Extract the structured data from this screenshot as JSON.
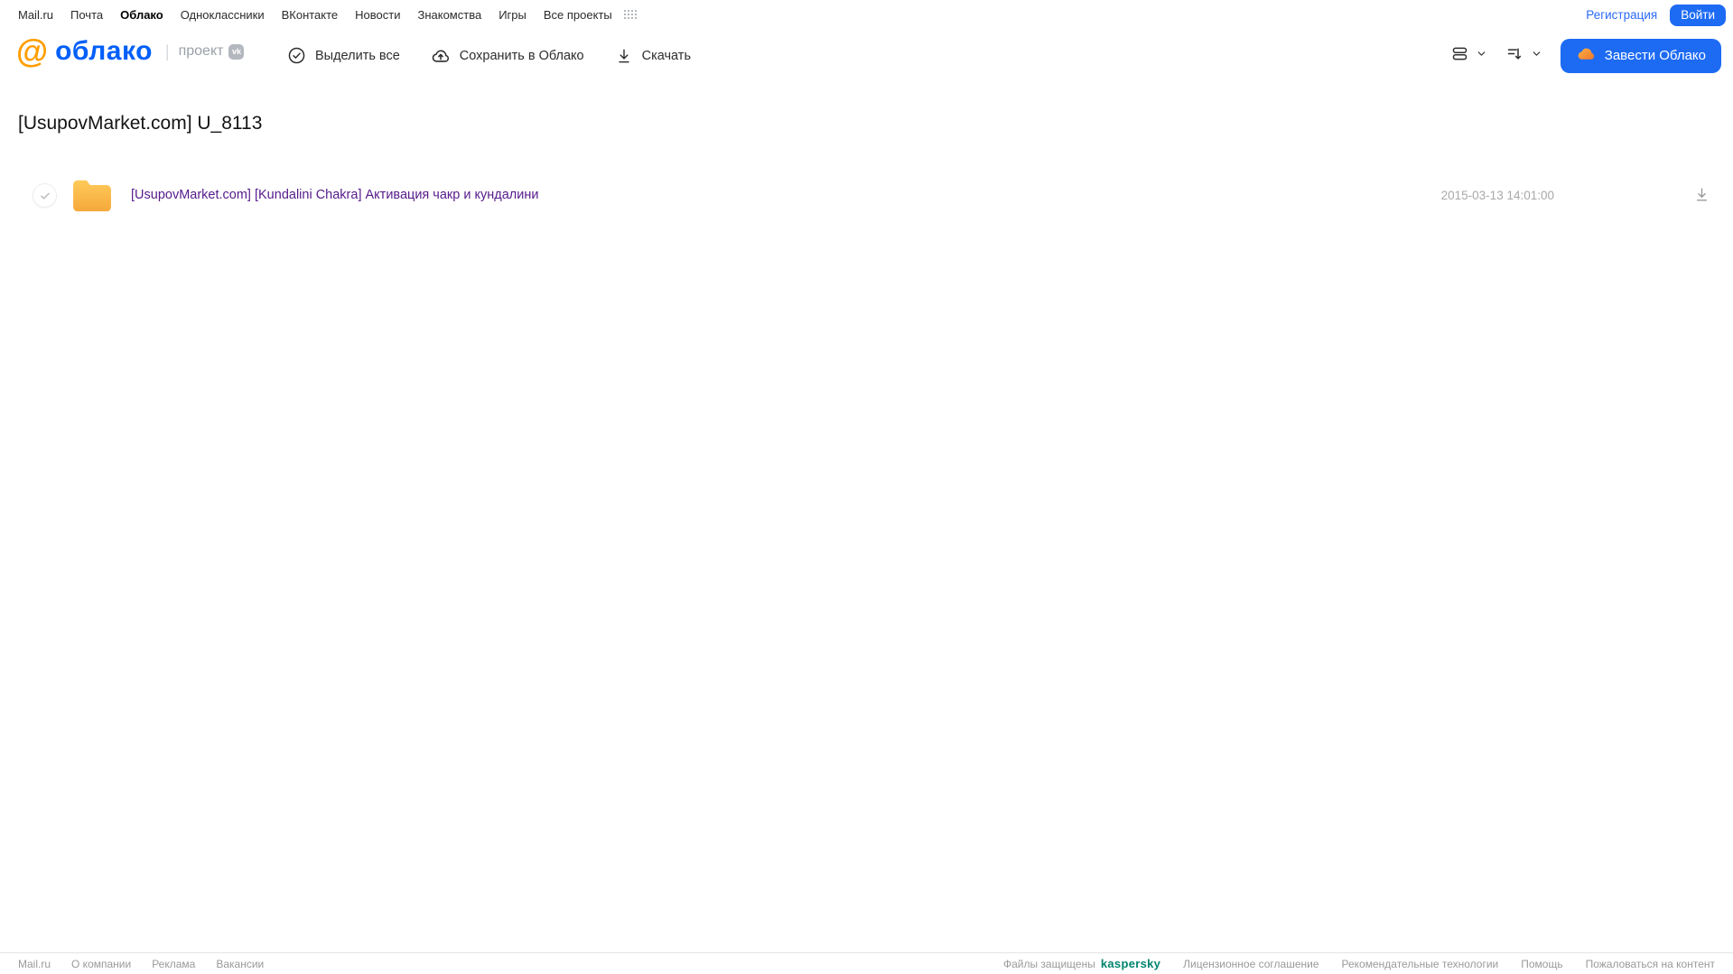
{
  "top_nav": {
    "items": [
      "Mail.ru",
      "Почта",
      "Облако",
      "Одноклассники",
      "ВКонтакте",
      "Новости",
      "Знакомства",
      "Игры",
      "Все проекты"
    ],
    "active_item": "Облако",
    "register_label": "Регистрация",
    "login_label": "Войти"
  },
  "header": {
    "logo_at": "@",
    "logo_text": "облако",
    "logo_divider": "|",
    "project_label": "проект",
    "vk_badge": "vk",
    "actions": {
      "select_all": "Выделить все",
      "save_to_cloud": "Сохранить в Облако",
      "download": "Скачать"
    },
    "get_cloud_button": "Завести Облако"
  },
  "page": {
    "title": "[UsupovMarket.com] U_8113"
  },
  "file_list": {
    "rows": [
      {
        "type": "folder",
        "name": "[UsupovMarket.com] [Kundalini Chakra] Активация чакр и кундалини",
        "date": "2015-03-13 14:01:00"
      }
    ]
  },
  "footer": {
    "left_links": [
      "Mail.ru",
      "О компании",
      "Реклама",
      "Вакансии"
    ],
    "protected_label": "Файлы защищены",
    "kaspersky_label": "kaspersky",
    "right_links": [
      "Лицензионное соглашение",
      "Рекомендательные технологии",
      "Помощь",
      "Пожаловаться на контент"
    ]
  },
  "colors": {
    "brand_blue": "#005ff9",
    "button_blue": "#1d6bf3",
    "logo_orange": "#ff9e00",
    "folder_amber_top": "#ffcb5c",
    "folder_amber_bottom": "#f5a93a",
    "visited_link_purple": "#551a8b",
    "kaspersky_teal": "#00846e",
    "muted_gray": "#a8a8a8"
  }
}
